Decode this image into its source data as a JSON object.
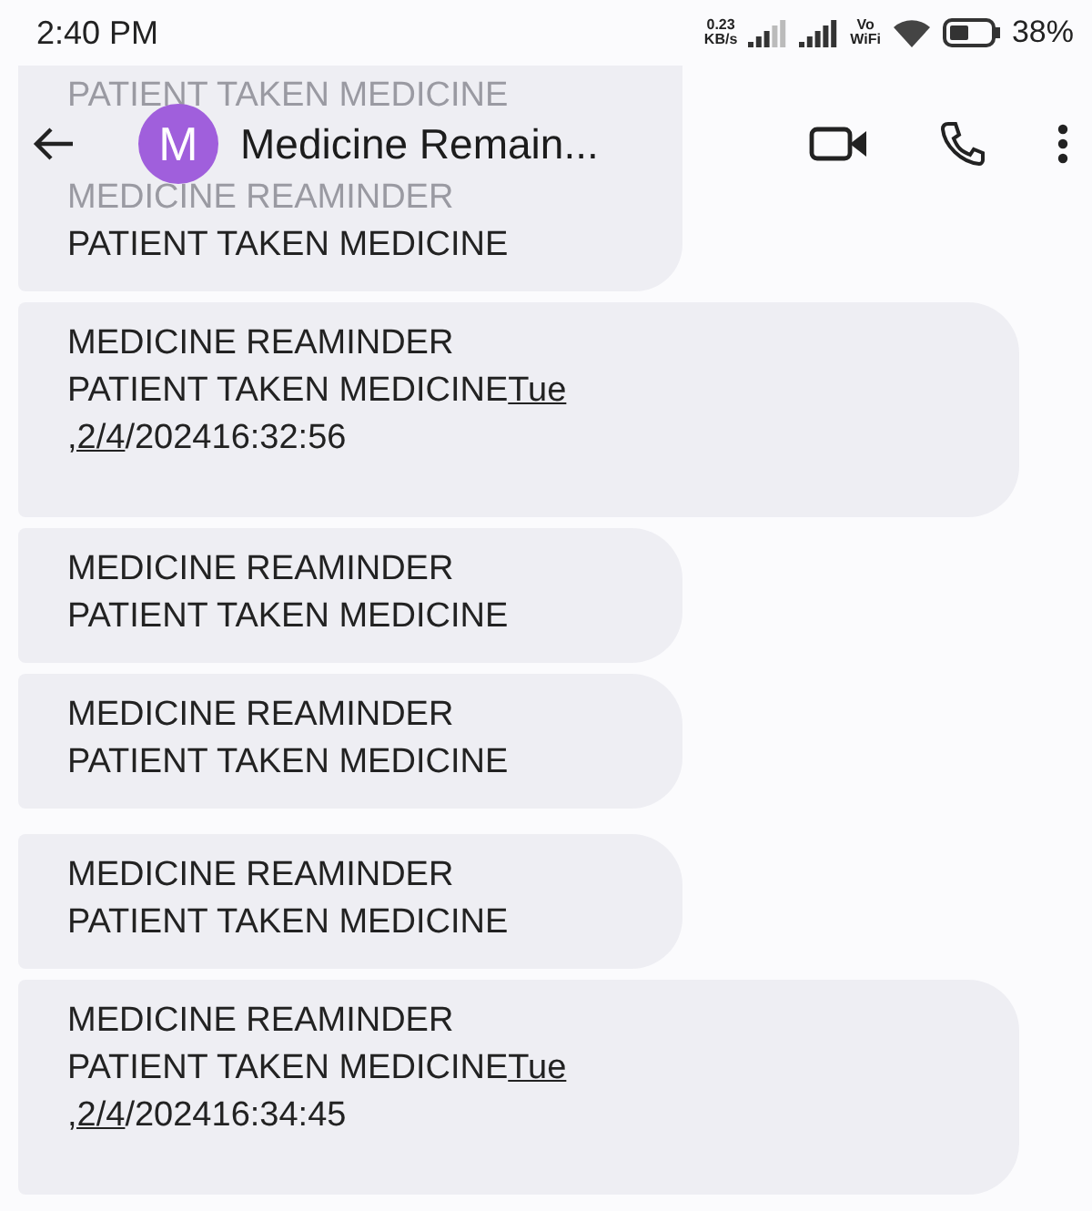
{
  "status_bar": {
    "time": "2:40 PM",
    "speed_value": "0.23",
    "speed_unit": "KB/s",
    "volte_top": "Vo",
    "volte_bottom": "WiFi",
    "battery": "38%"
  },
  "header": {
    "avatar_letter": "M",
    "title": "Medicine Remain..."
  },
  "message_groups": [
    [
      {
        "hidden_lines": [
          "PATIENT TAKEN MEDICINE",
          "MEDICINE REAMINDER"
        ],
        "lines": [
          "PATIENT TAKEN MEDICINE"
        ]
      },
      {
        "lines": [
          "MEDICINE REAMINDER",
          "PATIENT TAKEN MEDICINE"
        ],
        "date_link_start": "Tue",
        "date_link_end": ",2/4",
        "date_rest": "/202416:32:56"
      },
      {
        "lines": [
          "MEDICINE REAMINDER",
          "PATIENT TAKEN MEDICINE"
        ]
      },
      {
        "lines": [
          "MEDICINE REAMINDER",
          "PATIENT TAKEN MEDICINE"
        ]
      }
    ],
    [
      {
        "lines": [
          "MEDICINE REAMINDER",
          "PATIENT TAKEN MEDICINE"
        ]
      },
      {
        "lines": [
          "MEDICINE REAMINDER",
          "PATIENT TAKEN MEDICINE"
        ],
        "date_link_start": "Tue",
        "date_link_end": ",2/4",
        "date_rest": "/202416:34:45"
      }
    ]
  ]
}
